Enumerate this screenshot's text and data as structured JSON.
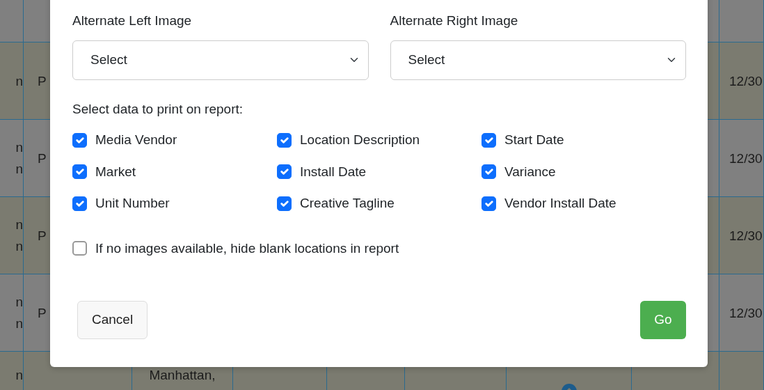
{
  "background_table": {
    "rows": [
      {},
      {
        "column_1": [
          "n"
        ],
        "column_2": [
          "P"
        ],
        "column_9": [
          "12/30"
        ]
      },
      {
        "column_1": [
          "n",
          "n"
        ],
        "column_2": [
          "P"
        ],
        "column_9": [
          "12/30"
        ]
      },
      {
        "column_1": [
          "n",
          "n"
        ],
        "column_2": [
          "P"
        ],
        "column_9": [
          "12/30"
        ]
      },
      {
        "column_1": [
          "n",
          "n"
        ],
        "column_2": [
          "P"
        ],
        "column_9": [
          "12/30"
        ]
      },
      {
        "column_1": [
          "n"
        ],
        "column_3": [
          "Manhattan,"
        ],
        "column_7": {
          "kind": "icon"
        }
      }
    ]
  },
  "dialog": {
    "selects": [
      {
        "label": "Alternate Left Image",
        "value": "Select"
      },
      {
        "label": "Alternate Right Image",
        "value": "Select"
      }
    ],
    "fields_heading": "Select data to print on report:",
    "fields": [
      {
        "label": "Media Vendor",
        "checked": true
      },
      {
        "label": "Location Description",
        "checked": true
      },
      {
        "label": "Start Date",
        "checked": true
      },
      {
        "label": "Market",
        "checked": true
      },
      {
        "label": "Install Date",
        "checked": true
      },
      {
        "label": "Variance",
        "checked": true
      },
      {
        "label": "Unit Number",
        "checked": true
      },
      {
        "label": "Creative Tagline",
        "checked": true
      },
      {
        "label": "Vendor Install Date",
        "checked": true
      }
    ],
    "hide_blank": {
      "label": "If no images available, hide blank locations in report",
      "checked": false
    },
    "cancel_button": "Cancel",
    "go_button": "Go"
  }
}
